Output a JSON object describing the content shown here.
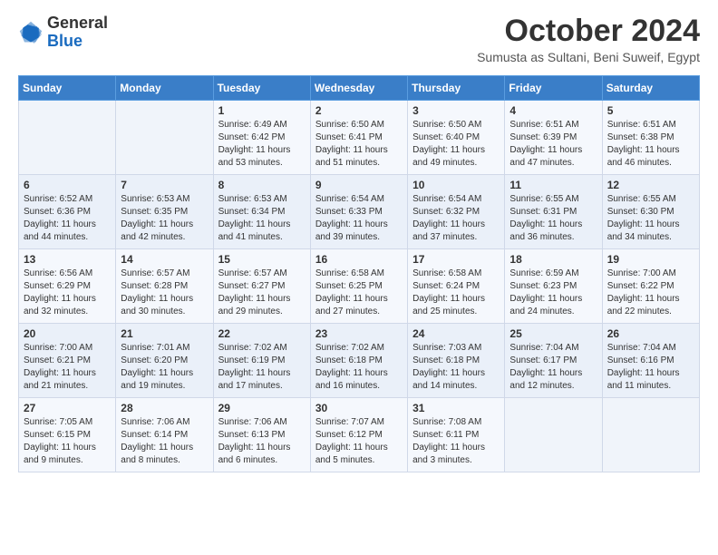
{
  "logo": {
    "general": "General",
    "blue": "Blue"
  },
  "title": "October 2024",
  "subtitle": "Sumusta as Sultani, Beni Suweif, Egypt",
  "weekdays": [
    "Sunday",
    "Monday",
    "Tuesday",
    "Wednesday",
    "Thursday",
    "Friday",
    "Saturday"
  ],
  "weeks": [
    [
      {
        "day": "",
        "empty": true
      },
      {
        "day": "",
        "empty": true
      },
      {
        "day": "1",
        "sunrise": "6:49 AM",
        "sunset": "6:42 PM",
        "daylight": "11 hours and 53 minutes."
      },
      {
        "day": "2",
        "sunrise": "6:50 AM",
        "sunset": "6:41 PM",
        "daylight": "11 hours and 51 minutes."
      },
      {
        "day": "3",
        "sunrise": "6:50 AM",
        "sunset": "6:40 PM",
        "daylight": "11 hours and 49 minutes."
      },
      {
        "day": "4",
        "sunrise": "6:51 AM",
        "sunset": "6:39 PM",
        "daylight": "11 hours and 47 minutes."
      },
      {
        "day": "5",
        "sunrise": "6:51 AM",
        "sunset": "6:38 PM",
        "daylight": "11 hours and 46 minutes."
      }
    ],
    [
      {
        "day": "6",
        "sunrise": "6:52 AM",
        "sunset": "6:36 PM",
        "daylight": "11 hours and 44 minutes."
      },
      {
        "day": "7",
        "sunrise": "6:53 AM",
        "sunset": "6:35 PM",
        "daylight": "11 hours and 42 minutes."
      },
      {
        "day": "8",
        "sunrise": "6:53 AM",
        "sunset": "6:34 PM",
        "daylight": "11 hours and 41 minutes."
      },
      {
        "day": "9",
        "sunrise": "6:54 AM",
        "sunset": "6:33 PM",
        "daylight": "11 hours and 39 minutes."
      },
      {
        "day": "10",
        "sunrise": "6:54 AM",
        "sunset": "6:32 PM",
        "daylight": "11 hours and 37 minutes."
      },
      {
        "day": "11",
        "sunrise": "6:55 AM",
        "sunset": "6:31 PM",
        "daylight": "11 hours and 36 minutes."
      },
      {
        "day": "12",
        "sunrise": "6:55 AM",
        "sunset": "6:30 PM",
        "daylight": "11 hours and 34 minutes."
      }
    ],
    [
      {
        "day": "13",
        "sunrise": "6:56 AM",
        "sunset": "6:29 PM",
        "daylight": "11 hours and 32 minutes."
      },
      {
        "day": "14",
        "sunrise": "6:57 AM",
        "sunset": "6:28 PM",
        "daylight": "11 hours and 30 minutes."
      },
      {
        "day": "15",
        "sunrise": "6:57 AM",
        "sunset": "6:27 PM",
        "daylight": "11 hours and 29 minutes."
      },
      {
        "day": "16",
        "sunrise": "6:58 AM",
        "sunset": "6:25 PM",
        "daylight": "11 hours and 27 minutes."
      },
      {
        "day": "17",
        "sunrise": "6:58 AM",
        "sunset": "6:24 PM",
        "daylight": "11 hours and 25 minutes."
      },
      {
        "day": "18",
        "sunrise": "6:59 AM",
        "sunset": "6:23 PM",
        "daylight": "11 hours and 24 minutes."
      },
      {
        "day": "19",
        "sunrise": "7:00 AM",
        "sunset": "6:22 PM",
        "daylight": "11 hours and 22 minutes."
      }
    ],
    [
      {
        "day": "20",
        "sunrise": "7:00 AM",
        "sunset": "6:21 PM",
        "daylight": "11 hours and 21 minutes."
      },
      {
        "day": "21",
        "sunrise": "7:01 AM",
        "sunset": "6:20 PM",
        "daylight": "11 hours and 19 minutes."
      },
      {
        "day": "22",
        "sunrise": "7:02 AM",
        "sunset": "6:19 PM",
        "daylight": "11 hours and 17 minutes."
      },
      {
        "day": "23",
        "sunrise": "7:02 AM",
        "sunset": "6:18 PM",
        "daylight": "11 hours and 16 minutes."
      },
      {
        "day": "24",
        "sunrise": "7:03 AM",
        "sunset": "6:18 PM",
        "daylight": "11 hours and 14 minutes."
      },
      {
        "day": "25",
        "sunrise": "7:04 AM",
        "sunset": "6:17 PM",
        "daylight": "11 hours and 12 minutes."
      },
      {
        "day": "26",
        "sunrise": "7:04 AM",
        "sunset": "6:16 PM",
        "daylight": "11 hours and 11 minutes."
      }
    ],
    [
      {
        "day": "27",
        "sunrise": "7:05 AM",
        "sunset": "6:15 PM",
        "daylight": "11 hours and 9 minutes."
      },
      {
        "day": "28",
        "sunrise": "7:06 AM",
        "sunset": "6:14 PM",
        "daylight": "11 hours and 8 minutes."
      },
      {
        "day": "29",
        "sunrise": "7:06 AM",
        "sunset": "6:13 PM",
        "daylight": "11 hours and 6 minutes."
      },
      {
        "day": "30",
        "sunrise": "7:07 AM",
        "sunset": "6:12 PM",
        "daylight": "11 hours and 5 minutes."
      },
      {
        "day": "31",
        "sunrise": "7:08 AM",
        "sunset": "6:11 PM",
        "daylight": "11 hours and 3 minutes."
      },
      {
        "day": "",
        "empty": true
      },
      {
        "day": "",
        "empty": true
      }
    ]
  ]
}
